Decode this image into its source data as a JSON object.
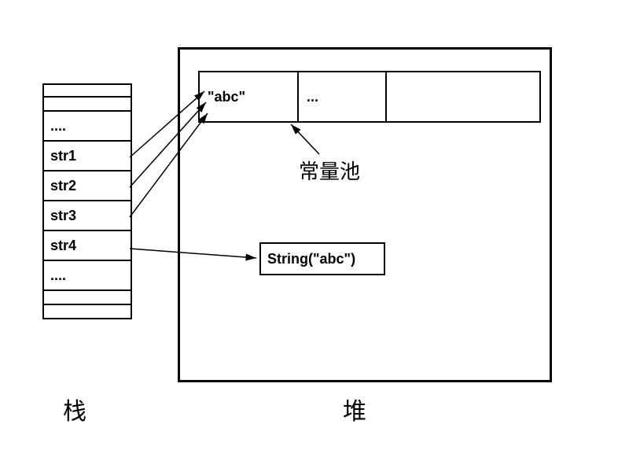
{
  "stack": {
    "label": "栈",
    "cells": [
      "....",
      "str1",
      "str2",
      "str3",
      "str4",
      "...."
    ]
  },
  "heap": {
    "label": "堆",
    "constant_pool": {
      "label": "常量池",
      "cells": [
        "\"abc\"",
        "...",
        ""
      ]
    },
    "string_object": {
      "text": "String(\"abc\")"
    }
  },
  "arrows": [
    {
      "from": "str1",
      "to": "pool_abc"
    },
    {
      "from": "str2",
      "to": "pool_abc"
    },
    {
      "from": "str3",
      "to": "pool_abc"
    },
    {
      "from": "str4",
      "to": "string_object"
    },
    {
      "from": "pool_label",
      "to": "pool_box"
    }
  ]
}
